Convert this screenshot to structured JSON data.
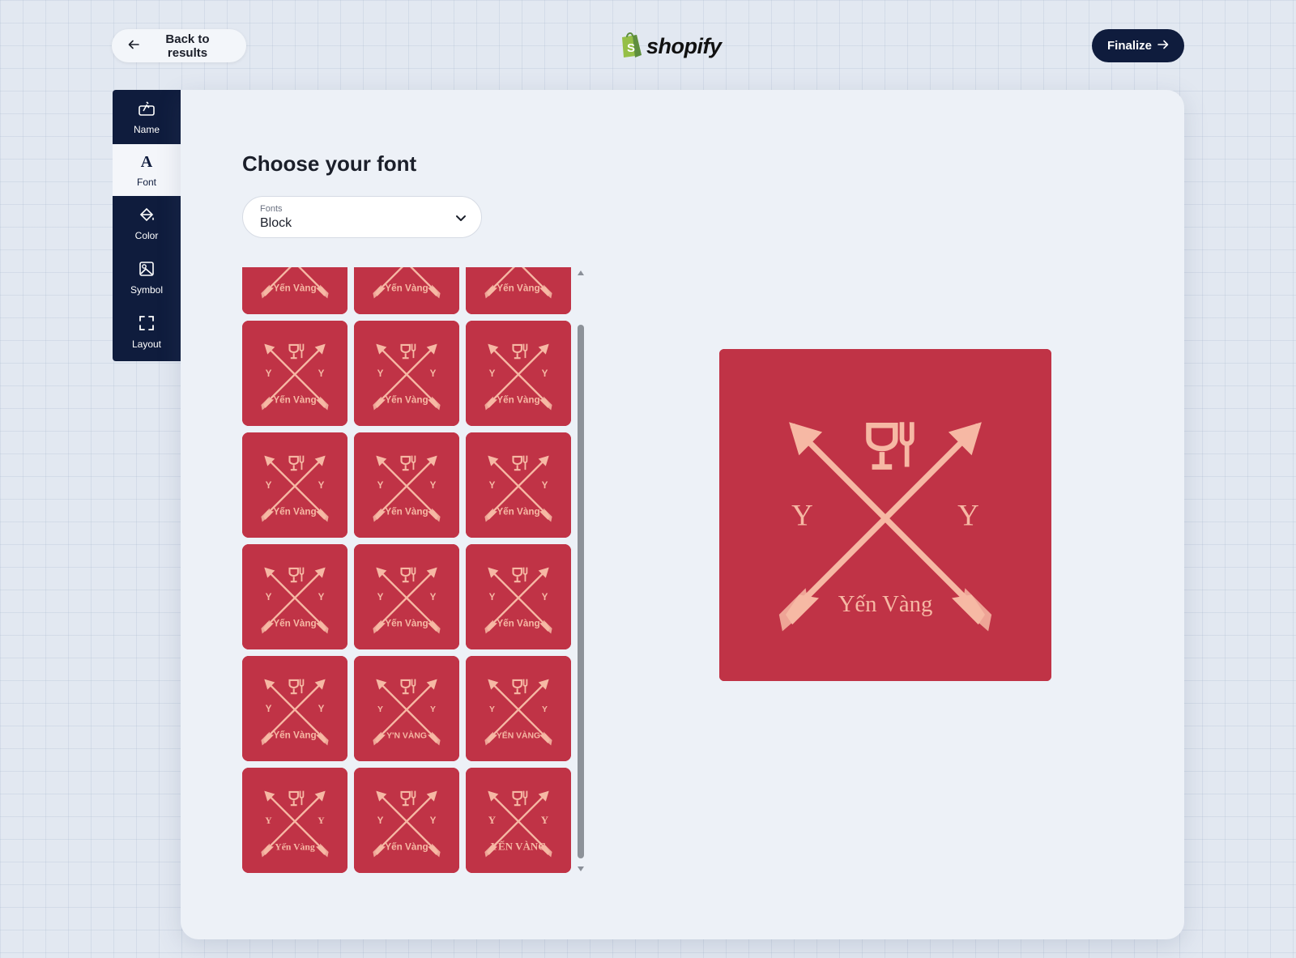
{
  "header": {
    "back_label": "Back to results",
    "logo_text": "shopify",
    "finalize_label": "Finalize"
  },
  "sidebar": {
    "items": [
      {
        "label": "Name",
        "icon": "name-icon"
      },
      {
        "label": "Font",
        "icon": "font-icon"
      },
      {
        "label": "Color",
        "icon": "paint-bucket-icon"
      },
      {
        "label": "Symbol",
        "icon": "symbol-icon"
      },
      {
        "label": "Layout",
        "icon": "layout-icon"
      }
    ],
    "active": "Font"
  },
  "main": {
    "title": "Choose your font",
    "font_select": {
      "label": "Fonts",
      "value": "Block"
    }
  },
  "logo_design": {
    "initial_left": "Y",
    "initial_right": "Y",
    "name": "Yến Vàng",
    "icon": "wine-glass-fork-icon",
    "background_color": "#c03346",
    "foreground_color": "#f6b8a4"
  },
  "font_options": [
    {
      "text": "Yến Vàng",
      "initial": "Y",
      "weight": "bold",
      "family": "sans",
      "size": 9
    },
    {
      "text": "Yến Vàng",
      "initial": "Y",
      "weight": "bold",
      "family": "sans",
      "size": 9
    },
    {
      "text": "Yến Vàng",
      "initial": "Y",
      "weight": "bold",
      "family": "sans",
      "size": 9
    },
    {
      "text": "Yến Vàng",
      "initial": "Y",
      "weight": "bold",
      "family": "sans",
      "size": 9
    },
    {
      "text": "Yến Vàng",
      "initial": "Y",
      "weight": "bold",
      "family": "sans",
      "size": 9
    },
    {
      "text": "Yến Vàng",
      "initial": "Y",
      "weight": "bold",
      "family": "sans",
      "size": 9
    },
    {
      "text": "Yến Vàng",
      "initial": "Y",
      "weight": "bold",
      "family": "sans",
      "size": 9
    },
    {
      "text": "Yến Vàng",
      "initial": "Y",
      "weight": "bold",
      "family": "sans",
      "size": 9
    },
    {
      "text": "Yến Vàng",
      "initial": "Y",
      "weight": "bold",
      "family": "sans",
      "size": 9
    },
    {
      "text": "Yến Vàng",
      "initial": "Y",
      "weight": "bold",
      "family": "sans",
      "size": 9
    },
    {
      "text": "Yến Vàng",
      "initial": "Y",
      "weight": "bold",
      "family": "sans",
      "size": 9
    },
    {
      "text": "Yến Vàng",
      "initial": "Y",
      "weight": "bold",
      "family": "sans",
      "size": 9
    },
    {
      "text": "Yến Vàng",
      "initial": "Y",
      "weight": "bold",
      "family": "sans",
      "size": 9
    },
    {
      "text": "Y'N VÀNG",
      "initial": "Y",
      "weight": "bold",
      "family": "sans",
      "size": 8
    },
    {
      "text": "YẾN VÀNG",
      "initial": "Y",
      "weight": "bold",
      "family": "sans",
      "size": 8
    },
    {
      "text": "Yến Vàng",
      "initial": "Y",
      "weight": "bold",
      "family": "serif",
      "size": 9
    },
    {
      "text": "Yến Vàng",
      "initial": "Y",
      "weight": "bold",
      "family": "sans",
      "size": 9
    },
    {
      "text": "YẾN VÀNG",
      "initial": "Y",
      "weight": "bold",
      "family": "serif",
      "size": 10
    }
  ]
}
